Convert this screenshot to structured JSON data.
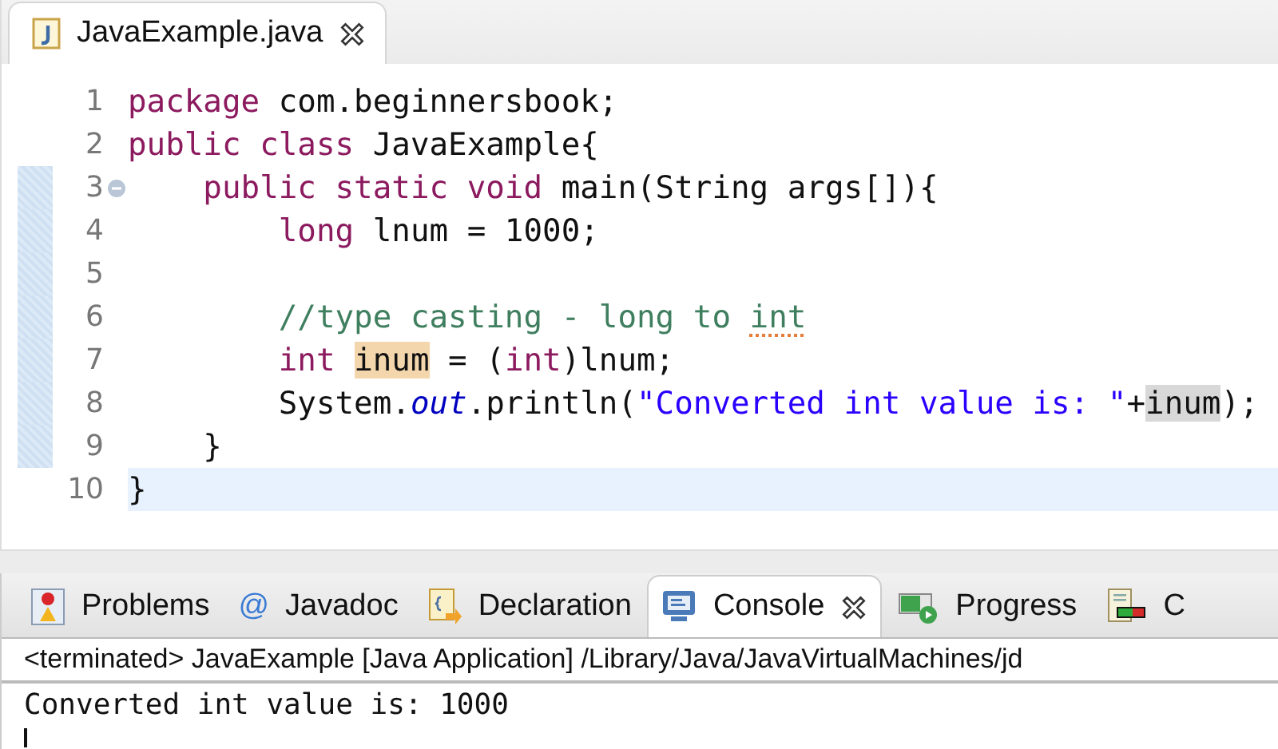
{
  "editor": {
    "tab": {
      "label": "JavaExample.java",
      "selected": true,
      "closable": true
    },
    "lines": [
      {
        "number": "1",
        "range_marked": false,
        "fold_marker": false,
        "current": false,
        "tokens": [
          {
            "kind": "keyword",
            "text": "package"
          },
          {
            "kind": "plain",
            "text": " com.beginnersbook;"
          }
        ]
      },
      {
        "number": "2",
        "range_marked": false,
        "fold_marker": false,
        "current": false,
        "tokens": [
          {
            "kind": "keyword",
            "text": "public class"
          },
          {
            "kind": "plain",
            "text": " JavaExample{"
          }
        ]
      },
      {
        "number": "3",
        "range_marked": true,
        "fold_marker": true,
        "current": false,
        "tokens": [
          {
            "kind": "keyword",
            "text": "    public static void"
          },
          {
            "kind": "plain",
            "text": " main(String args[]){"
          }
        ]
      },
      {
        "number": "4",
        "range_marked": true,
        "fold_marker": false,
        "current": false,
        "tokens": [
          {
            "kind": "keyword",
            "text": "        long"
          },
          {
            "kind": "plain",
            "text": " lnum = 1000;"
          }
        ]
      },
      {
        "number": "5",
        "range_marked": true,
        "fold_marker": false,
        "current": false
      },
      {
        "number": "6",
        "range_marked": true,
        "fold_marker": false,
        "current": false,
        "tokens": [
          {
            "kind": "comment",
            "text": "        //type casting - long to "
          },
          {
            "kind": "comment-typo",
            "text": "int"
          }
        ]
      },
      {
        "number": "7",
        "range_marked": true,
        "fold_marker": false,
        "current": false,
        "tokens": [
          {
            "kind": "keyword",
            "text": "        int "
          },
          {
            "kind": "occurrence-write",
            "text": "inum"
          },
          {
            "kind": "plain",
            "text": " = ("
          },
          {
            "kind": "keyword",
            "text": "int"
          },
          {
            "kind": "plain",
            "text": ")lnum;"
          }
        ]
      },
      {
        "number": "8",
        "range_marked": true,
        "fold_marker": false,
        "current": false,
        "tokens": [
          {
            "kind": "plain",
            "text": "        System."
          },
          {
            "kind": "static-field",
            "text": "out"
          },
          {
            "kind": "plain",
            "text": ".println("
          },
          {
            "kind": "string",
            "text": "\"Converted int value is: \""
          },
          {
            "kind": "plain",
            "text": "+"
          },
          {
            "kind": "occurrence-read",
            "text": "inum"
          },
          {
            "kind": "plain",
            "text": ");"
          }
        ]
      },
      {
        "number": "9",
        "range_marked": true,
        "fold_marker": false,
        "current": false,
        "tokens": [
          {
            "kind": "plain",
            "text": "    }"
          }
        ]
      },
      {
        "number": "10",
        "range_marked": false,
        "fold_marker": false,
        "current": true,
        "tokens": [
          {
            "kind": "plain",
            "text": "}"
          }
        ]
      }
    ]
  },
  "panel": {
    "tabs": [
      {
        "kind": "problems",
        "label": "Problems",
        "selected": false,
        "closable": false
      },
      {
        "kind": "javadoc",
        "icon": "@",
        "label": "Javadoc",
        "selected": false,
        "closable": false
      },
      {
        "kind": "declaration",
        "label": "Declaration",
        "selected": false,
        "closable": false
      },
      {
        "kind": "console",
        "label": "Console",
        "selected": true,
        "closable": true
      },
      {
        "kind": "progress",
        "label": "Progress",
        "selected": false,
        "closable": false
      },
      {
        "kind": "coverage",
        "label": "C",
        "selected": false,
        "closable": false
      }
    ],
    "console_header": "<terminated> JavaExample [Java Application] /Library/Java/JavaVirtualMachines/jd",
    "output": [
      "Converted int value is: 1000"
    ],
    "cursor": true
  }
}
